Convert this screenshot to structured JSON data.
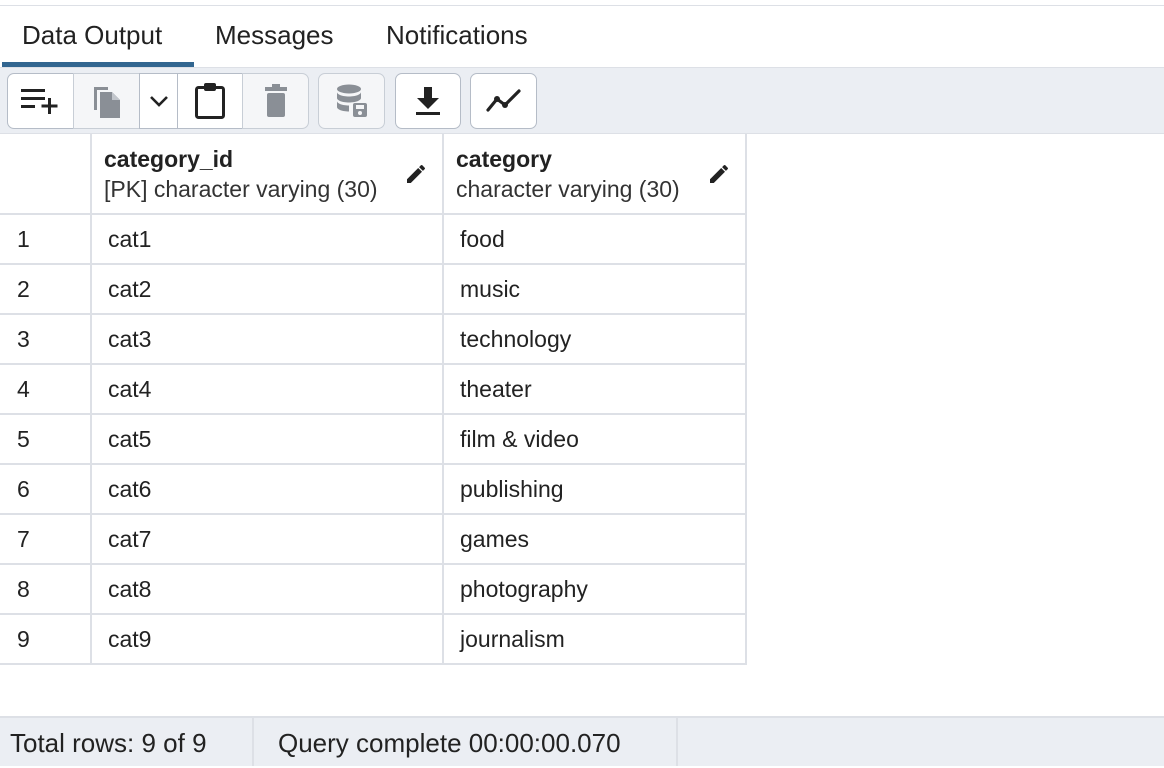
{
  "tabs": [
    {
      "label": "Data Output",
      "active": true
    },
    {
      "label": "Messages",
      "active": false
    },
    {
      "label": "Notifications",
      "active": false
    }
  ],
  "toolbar": {
    "buttons": [
      {
        "name": "add-row",
        "icon": "add-row-icon"
      },
      {
        "name": "copy",
        "icon": "copy-icon"
      },
      {
        "name": "copy-options",
        "icon": "chevron-down-icon"
      },
      {
        "name": "paste",
        "icon": "clipboard-icon"
      },
      {
        "name": "delete",
        "icon": "trash-icon"
      },
      {
        "name": "save-data",
        "icon": "database-save-icon"
      },
      {
        "name": "download",
        "icon": "download-icon"
      },
      {
        "name": "graph-visualiser",
        "icon": "line-chart-icon"
      }
    ]
  },
  "grid": {
    "columns": [
      {
        "name": "category_id",
        "type": "[PK] character varying (30)"
      },
      {
        "name": "category",
        "type": "character varying (30)"
      }
    ],
    "rows": [
      {
        "num": "1",
        "category_id": "cat1",
        "category": "food"
      },
      {
        "num": "2",
        "category_id": "cat2",
        "category": "music"
      },
      {
        "num": "3",
        "category_id": "cat3",
        "category": "technology"
      },
      {
        "num": "4",
        "category_id": "cat4",
        "category": "theater"
      },
      {
        "num": "5",
        "category_id": "cat5",
        "category": "film & video"
      },
      {
        "num": "6",
        "category_id": "cat6",
        "category": "publishing"
      },
      {
        "num": "7",
        "category_id": "cat7",
        "category": "games"
      },
      {
        "num": "8",
        "category_id": "cat8",
        "category": "photography"
      },
      {
        "num": "9",
        "category_id": "cat9",
        "category": "journalism"
      }
    ]
  },
  "status": {
    "rows_text": "Total rows: 9 of 9",
    "query_text": "Query complete 00:00:00.070"
  },
  "colors": {
    "accent": "#326690",
    "toolbar_bg": "#ebeef3",
    "border": "#dde0e6"
  }
}
